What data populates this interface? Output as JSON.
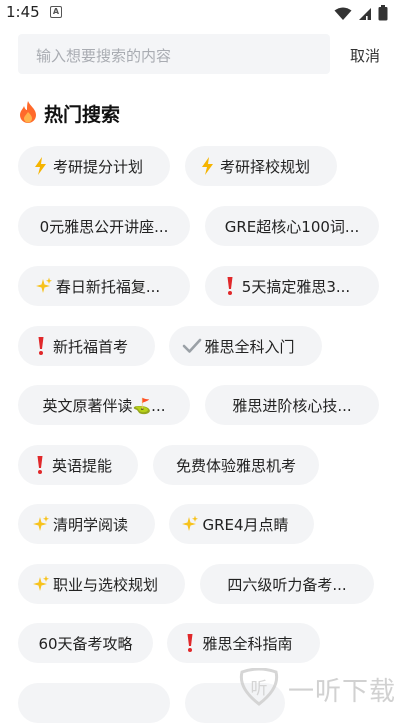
{
  "status": {
    "time": "1:45",
    "notification_glyph": "A"
  },
  "search": {
    "placeholder": "输入想要搜索的内容",
    "cancel_label": "取消"
  },
  "hot": {
    "title": "热门搜索"
  },
  "chips": [
    {
      "label": "考研提分计划",
      "icon": "lightning-icon"
    },
    {
      "label": "考研择校规划",
      "icon": "lightning-icon"
    },
    {
      "label": "0元雅思公开讲座...",
      "icon": ""
    },
    {
      "label": "GRE超核心100词...",
      "icon": ""
    },
    {
      "label": "春日新托福复...",
      "icon": "sparkle-icon"
    },
    {
      "label": "5天搞定雅思3...",
      "icon": "exclamation-icon"
    },
    {
      "label": "新托福首考",
      "icon": "exclamation-icon"
    },
    {
      "label": "雅思全科入门",
      "icon": "checkmark-icon"
    },
    {
      "label": "英文原著伴读⛳...",
      "icon": ""
    },
    {
      "label": "雅思进阶核心技...",
      "icon": ""
    },
    {
      "label": "英语提能",
      "icon": "exclamation-icon"
    },
    {
      "label": "免费体验雅思机考",
      "icon": ""
    },
    {
      "label": "清明学阅读",
      "icon": "sparkle-icon"
    },
    {
      "label": "GRE4月点睛",
      "icon": "sparkle-icon"
    },
    {
      "label": "职业与选校规划",
      "icon": "sparkle-icon"
    },
    {
      "label": "四六级听力备考...",
      "icon": ""
    },
    {
      "label": "60天备考攻略",
      "icon": ""
    },
    {
      "label": "雅思全科指南",
      "icon": "exclamation-icon"
    }
  ],
  "watermark": {
    "text": "一听下载"
  }
}
